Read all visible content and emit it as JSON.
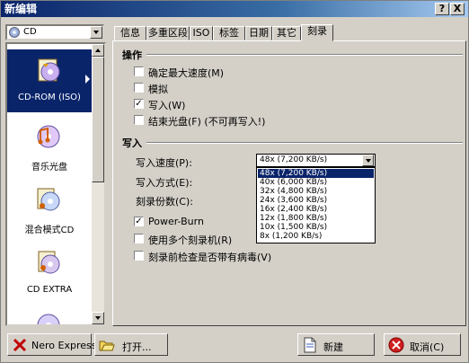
{
  "window": {
    "title": "新编辑",
    "help_label": "?",
    "close_label": "X"
  },
  "disc_type": {
    "selected": "CD",
    "icon": "cd-disc-icon"
  },
  "compilations": [
    {
      "label": "CD-ROM (ISO)",
      "icon": "cd-rom-icon",
      "selected": true
    },
    {
      "label": "音乐光盘",
      "icon": "audio-cd-icon"
    },
    {
      "label": "混合模式CD",
      "icon": "mixed-mode-cd-icon"
    },
    {
      "label": "CD EXTRA",
      "icon": "cd-extra-icon"
    }
  ],
  "tabs": [
    "信息",
    "多重区段",
    "ISO",
    "标签",
    "日期",
    "其它",
    "刻录"
  ],
  "active_tab": "刻录",
  "actions": {
    "heading": "操作",
    "options": [
      {
        "label": "确定最大速度(M)",
        "checked": false
      },
      {
        "label": "模拟",
        "checked": false
      },
      {
        "label": "写入(W)",
        "checked": true
      },
      {
        "label": "结束光盘(F) (不可再写入!)",
        "checked": false
      }
    ]
  },
  "write": {
    "heading": "写入",
    "speed_label": "写入速度(P):",
    "method_label": "写入方式(E):",
    "copies_label": "刻录份数(C):",
    "speed_selected": "48x (7,200 KB/s)",
    "speed_options": [
      "48x (7,200 KB/s)",
      "40x (6,000 KB/s)",
      "32x (4,800 KB/s)",
      "24x (3,600 KB/s)",
      "16x (2,400 KB/s)",
      "12x (1,800 KB/s)",
      "10x (1,500 KB/s)",
      "8x (1,200 KB/s)"
    ],
    "highlighted_option": "48x (7,200 KB/s)",
    "options": [
      {
        "label": "Power-Burn",
        "checked": true
      },
      {
        "label": "使用多个刻录机(R)",
        "checked": false
      },
      {
        "label": "刻录前检查是否带有病毒(V)",
        "checked": false
      }
    ]
  },
  "buttons": {
    "nero_express": "Nero Express(X)",
    "open": "打开...",
    "new": "新建",
    "cancel": "取消(C)"
  },
  "colors": {
    "titlebar": "#0a246a",
    "selection": "#0a246a",
    "face": "#d4d0c8"
  }
}
